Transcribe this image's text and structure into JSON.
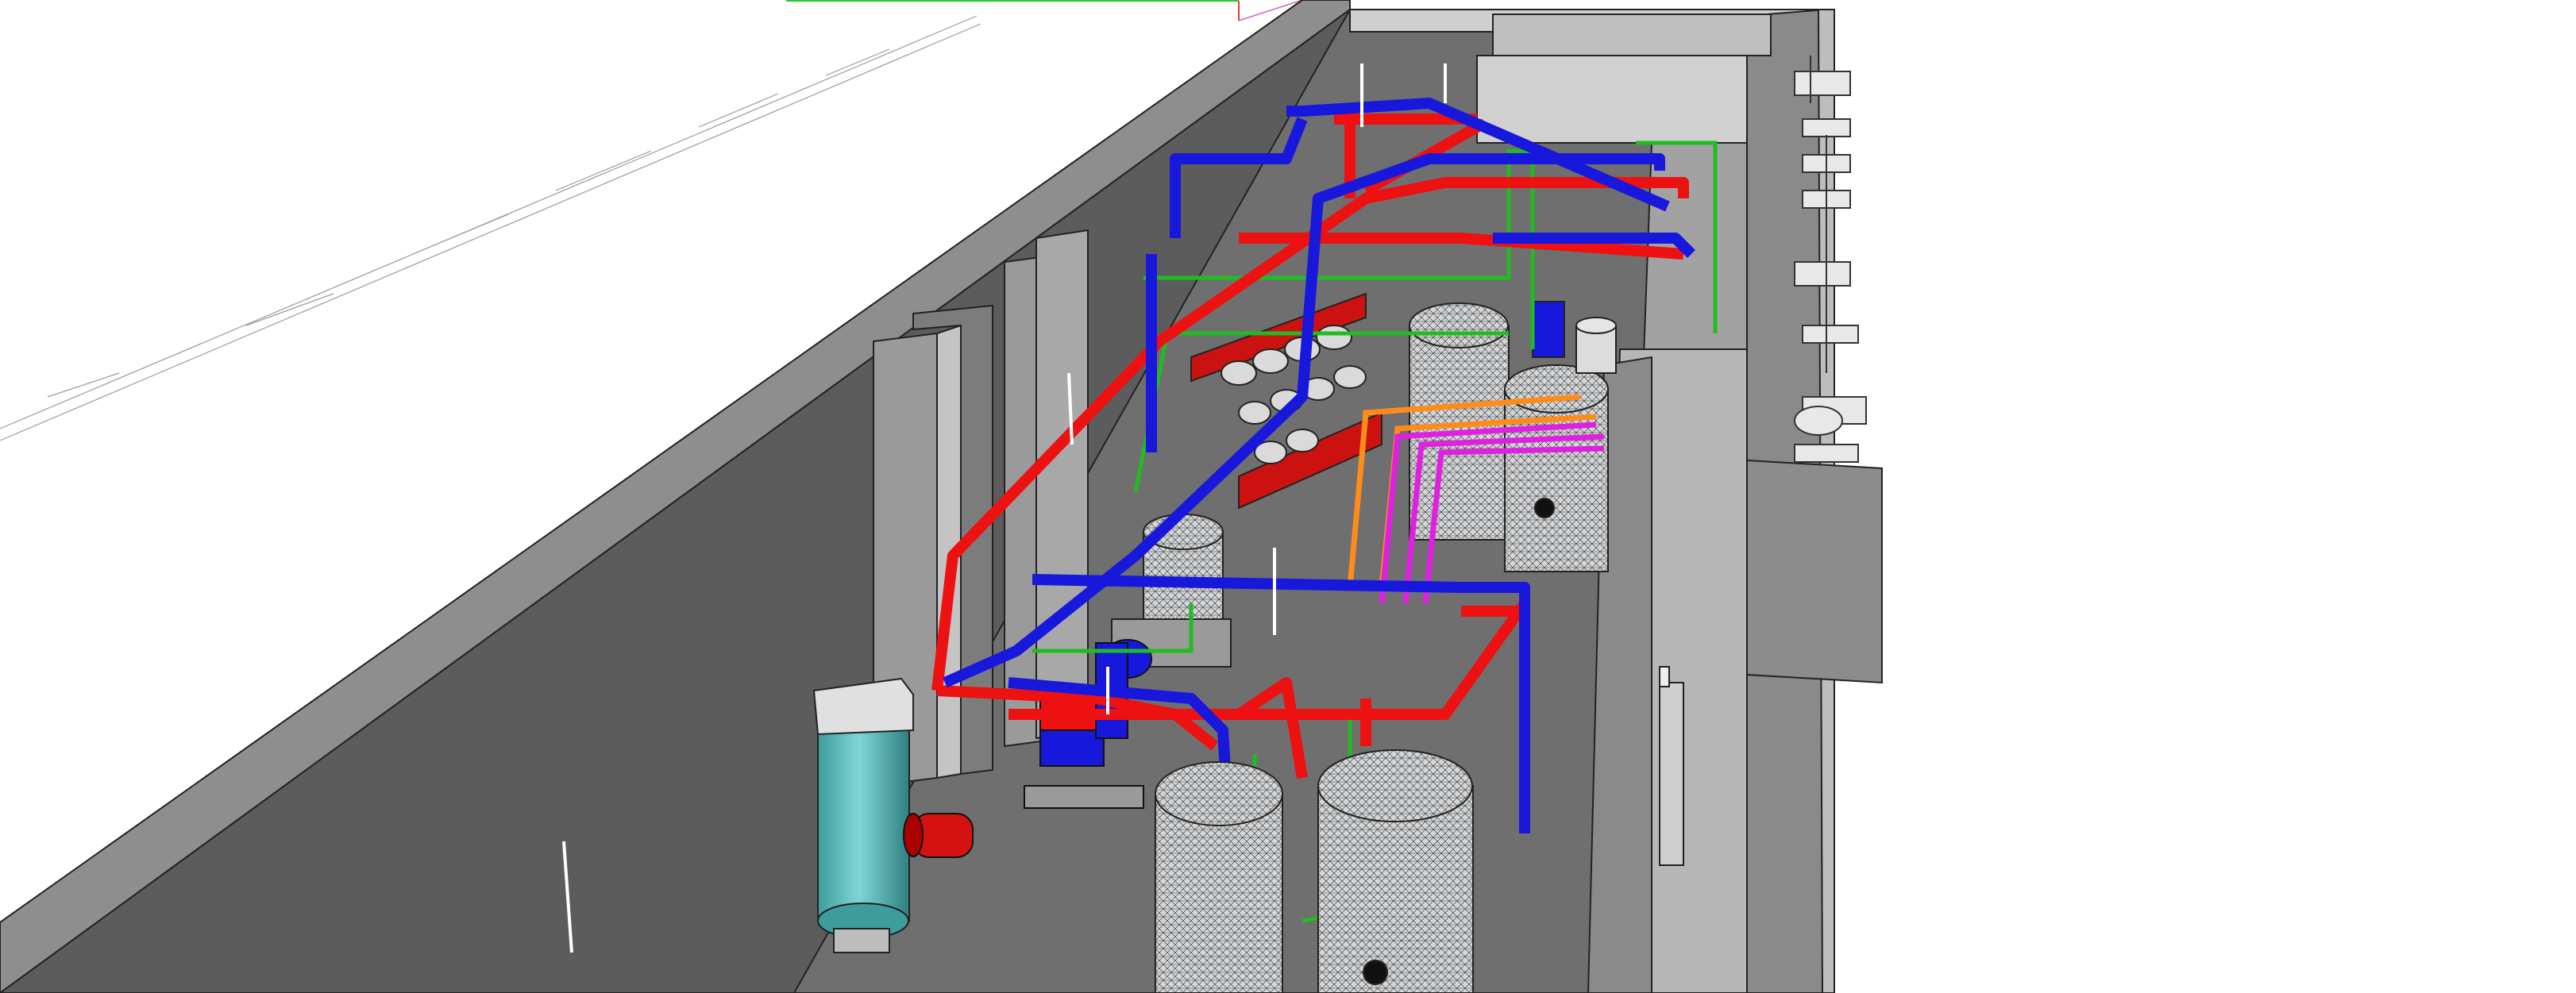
{
  "scene": {
    "kind": "3D model viewport, isometric view of a plant room with boiler piping",
    "colors": {
      "background": "#ffffff",
      "floor": "#6b6b6b",
      "wall_left": "#5a5a5a",
      "wall_top": "#8e8e8e",
      "wall_right": "#9a9a9a",
      "hot_pipe": "#ee1111",
      "cold_pipe": "#1818dd",
      "gas_pipe": "#22bb22",
      "magenta_pipe": "#e020e0",
      "orange_pipe": "#ff8c1a",
      "tank_teal": "#5fbcbc",
      "tank_mesh": "#cfcfcf",
      "axis_green": "#22cc22",
      "axis_red": "#ee3333"
    },
    "objects": [
      "expansion-vessel-teal",
      "header-red",
      "pump-blue",
      "storage-tank-front-left",
      "storage-tank-front-right",
      "storage-tank-rear-left",
      "storage-tank-rear-right",
      "heat-exchanger",
      "riser-columns",
      "boiler-row"
    ]
  }
}
